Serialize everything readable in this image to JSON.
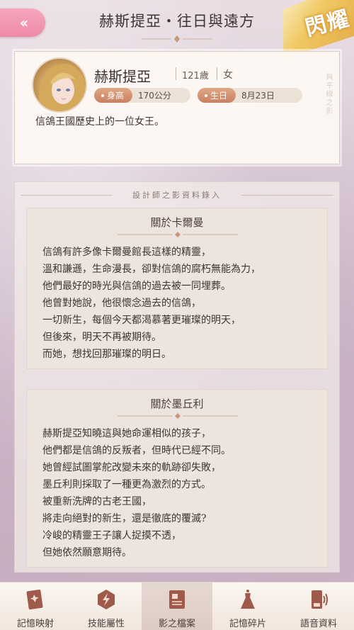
{
  "header": {
    "back_icon": "double-chevron-left-icon",
    "title": "赫斯提亞・往日與遠方",
    "badge": "閃耀"
  },
  "profile": {
    "name": "赫斯提亞",
    "age": "121歲",
    "gender": "女",
    "height_label": "身高",
    "height_value": "170公分",
    "birthday_label": "生日",
    "birthday_value": "8月23日",
    "description": "信鴿王國歷史上的一位女王。",
    "vertical_text": "與平線之影"
  },
  "records": {
    "heading": "設計師之影資料錄入",
    "cards": [
      {
        "title": "關於卡爾曼",
        "lines": [
          "信鴿有許多像卡爾曼館長這樣的精靈，",
          "溫和謙遜，生命漫長，卻對信鴿的腐朽無能為力，",
          "他們最好的時光與信鴿的過去被一同埋葬。",
          "他曾對她說，他很懷念過去的信鴿，",
          "一切新生，每個今天都渴慕著更璀璨的明天，",
          "但後來，明天不再被期待。",
          "而她，想找回那璀璨的明日。"
        ]
      },
      {
        "title": "關於墨丘利",
        "lines": [
          "赫斯提亞知曉這與她命運相似的孩子，",
          "他們都是信鴿的反叛者，但時代已經不同。",
          "她曾經試圖掌舵改變未來的軌跡卻失敗，",
          "墨丘利則採取了一種更為激烈的方式。",
          "被重新洗牌的古老王國，",
          "將走向絕對的新生，還是徹底的覆滅?",
          "冷峻的精靈王子讓人捉摸不透，",
          "但她依然願意期待。"
        ]
      }
    ]
  },
  "nav": {
    "items": [
      {
        "label": "記憶映射",
        "icon": "card-icon"
      },
      {
        "label": "技能屬性",
        "icon": "lightning-icon"
      },
      {
        "label": "影之檔案",
        "icon": "file-icon"
      },
      {
        "label": "記憶碎片",
        "icon": "dress-icon"
      },
      {
        "label": "語音資料",
        "icon": "phone-icon"
      }
    ],
    "active": "影之檔案"
  }
}
